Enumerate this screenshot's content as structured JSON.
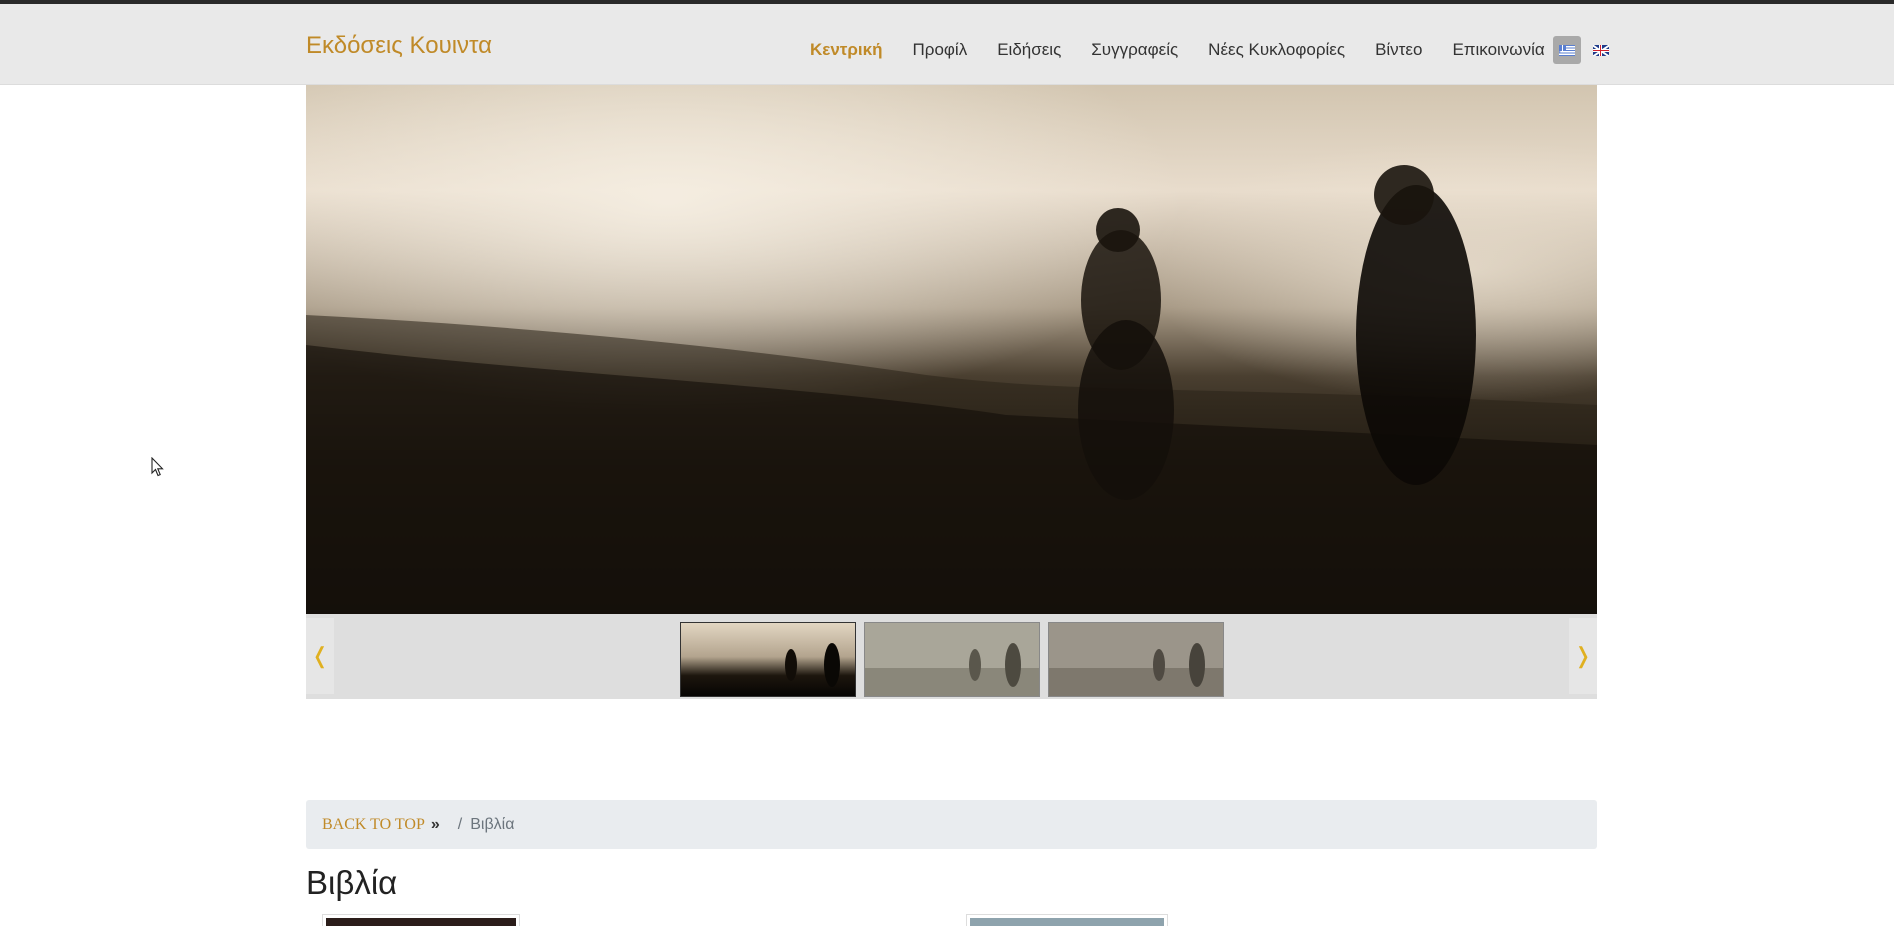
{
  "brand": "Εκδόσεις Κουιντα",
  "nav": {
    "items": [
      {
        "label": "Κεντρική",
        "active": true
      },
      {
        "label": "Προφίλ"
      },
      {
        "label": "Ειδήσεις"
      },
      {
        "label": "Συγγραφείς"
      },
      {
        "label": "Νέες Κυκλοφορίες"
      },
      {
        "label": "Βίντεο"
      },
      {
        "label": "Επικοινωνία"
      }
    ],
    "languages": [
      "greek-flag-icon",
      "uk-flag-icon"
    ]
  },
  "slider": {
    "prev_icon": "❬",
    "next_icon": "❭",
    "thumbnail_count": 3,
    "active_thumbnail": 1
  },
  "breadcrumb": {
    "back_label": "BACK TO TOP",
    "back_suffix": "»",
    "separator": "/",
    "current": "Βιβλία"
  },
  "page_title": "Βιβλία",
  "colors": {
    "accent": "#c08a28",
    "arrow": "#e0b020",
    "navbar_bg": "#e9e9e9",
    "breadcrumb_bg": "#e9ecef"
  }
}
